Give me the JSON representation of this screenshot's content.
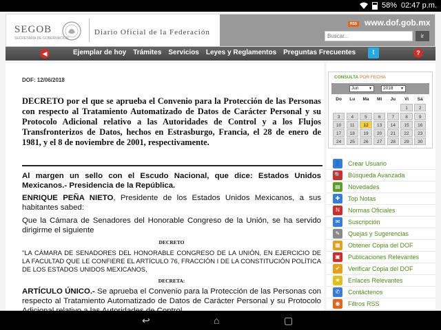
{
  "status_bar": {
    "battery": "58%",
    "time": "02:47 p.m.",
    "icons": [
      "wifi-icon",
      "battery-icon"
    ]
  },
  "header": {
    "logo_text": "SEGOB",
    "logo_subtext": "SECRETARÍA DE GOBERNACIÓN",
    "title": "Diario Oficial de la Federación",
    "rss_badge": "RSS",
    "site_url": "www.dof.gob.mx",
    "search_placeholder": "Buscar...",
    "search_button": "ir"
  },
  "nav": {
    "items": [
      "Ejemplar de hoy",
      "Trámites",
      "Servicios",
      "Leyes y Reglamentos",
      "Preguntas Frecuentes"
    ],
    "home_icon": "home-icon",
    "twitter_icon": "twitter-icon",
    "help_icon": "help-icon"
  },
  "document": {
    "date": "DOF: 12/06/2018",
    "title": "DECRETO por el que se aprueba el Convenio para la Protección de las Personas con respecto al Tratamiento Automatizado de Datos de Carácter Personal y su Protocolo Adicional relativo a las Autoridades de Control y a los Flujos Transfronterizos de Datos, hechos en Estrasburgo, Francia, el 28 de enero de 1981, y el 8 de noviembre de 2001, respectivamente.",
    "margin_text": "Al margen un sello con el Escudo Nacional, que dice: Estados Unidos Mexicanos.- Presidencia de la República.",
    "p1_name": "ENRIQUE PEÑA NIETO",
    "p1_rest": ", Presidente de los Estados Unidos Mexicanos, a sus habitantes sabed:",
    "p2": "Que la Cámara de Senadores del Honorable Congreso de la Unión, se ha servido dirigirme el siguiente",
    "decreto_label": "DECRETO",
    "quote": "\"LA CÁMARA DE SENADORES DEL HONORABLE CONGRESO DE LA UNIÓN, EN EJERCICIO DE LA FACULTAD QUE LE CONFIERE EL ARTÍCULO 76, FRACCIÓN I DE LA CONSTITUCIÓN POLÍTICA DE LOS ESTADOS UNIDOS MEXICANOS,",
    "decreta_label": "DECRETA:",
    "p3_bold": "ARTÍCULO ÚNICO.-",
    "p3_rest": " Se aprueba el Convenio para la Protección de las Personas con respecto al Tratamiento Automatizado de Datos de Carácter Personal y su Protocolo Adicional relativo a las Autoridades de Control"
  },
  "calendar": {
    "header_main": "CONSULTA",
    "header_sub": " POR FECHA",
    "month": "Jun",
    "year": "2018",
    "day_headers": [
      "Do",
      "Lu",
      "Ma",
      "Mi",
      "Ju",
      "Vi",
      "Sá"
    ],
    "weeks": [
      [
        "",
        "",
        "",
        "",
        "",
        "1",
        "2"
      ],
      [
        "3",
        "4",
        "5",
        "6",
        "7",
        "8",
        "9"
      ],
      [
        "10",
        "11",
        "12",
        "13",
        "14",
        "15",
        "16"
      ],
      [
        "17",
        "18",
        "19",
        "20",
        "21",
        "22",
        "23"
      ],
      [
        "24",
        "25",
        "26",
        "27",
        "28",
        "29",
        "30"
      ]
    ],
    "selected_day": "12"
  },
  "sidebar_links": [
    {
      "label": "Crear Usuario",
      "icon": "user-add-icon",
      "color": "#3a7bd5",
      "glyph": "👤"
    },
    {
      "label": "Búsqueda Avanzada",
      "icon": "search-icon",
      "color": "#c9302c",
      "glyph": "🔍"
    },
    {
      "label": "Novedades",
      "icon": "news-icon",
      "color": "#5a9e2a",
      "glyph": "▤"
    },
    {
      "label": "Top Notas",
      "icon": "top-notes-icon",
      "color": "#3a7bd5",
      "glyph": "✚"
    },
    {
      "label": "Normas Oficiales",
      "icon": "nom-icon",
      "color": "#c9302c",
      "glyph": "N"
    },
    {
      "label": "Suscripción",
      "icon": "subscription-icon",
      "color": "#3a7bd5",
      "glyph": "✉"
    },
    {
      "label": "Quejas y Sugerencias",
      "icon": "complaints-icon",
      "color": "#8a8a8a",
      "glyph": "✎"
    },
    {
      "label": "Obtener Copia del DOF",
      "icon": "copy-icon",
      "color": "#e0a020",
      "glyph": "▦"
    },
    {
      "label": "Publicaciones Relevantes",
      "icon": "publications-icon",
      "color": "#c9302c",
      "glyph": "▣"
    },
    {
      "label": "Verificar Copia del DOF",
      "icon": "verify-icon",
      "color": "#e0a020",
      "glyph": "✔"
    },
    {
      "label": "Enlaces Relevantes",
      "icon": "star-icon",
      "color": "#e0c020",
      "glyph": "★"
    },
    {
      "label": "Contáctenos",
      "icon": "contact-icon",
      "color": "#3a7bd5",
      "glyph": "✆"
    },
    {
      "label": "Filtros RSS",
      "icon": "rss-icon",
      "color": "#e0651f",
      "glyph": "◉"
    }
  ]
}
